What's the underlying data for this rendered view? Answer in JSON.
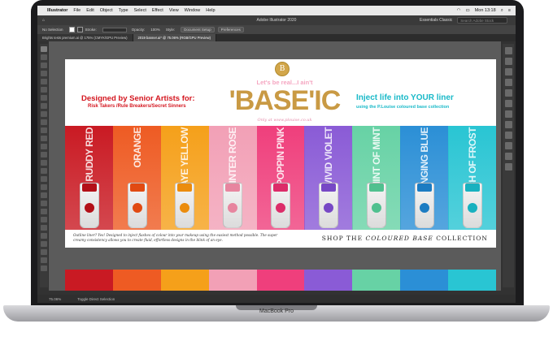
{
  "device": {
    "label": "MacBook Pro"
  },
  "menubar": {
    "app_name": "Illustrator",
    "items": [
      "File",
      "Edit",
      "Object",
      "Type",
      "Select",
      "Effect",
      "View",
      "Window",
      "Help"
    ],
    "clock": "Mon 13:18"
  },
  "control": {
    "title": "Adobe Illustrator 2020",
    "workspace": "Essentials Classic",
    "search_placeholder": "Search Adobe Stock"
  },
  "options": {
    "selection": "No Selection",
    "stroke_label": "Stroke:",
    "opacity_label": "Opacity:",
    "opacity_value": "100%",
    "style_label": "Style:",
    "doc_setup": "Document Setup",
    "preferences": "Preferences"
  },
  "tabs": [
    {
      "label": "Brights tests premium.ai @ 175% (CMYK/GPU Preview)"
    },
    {
      "label": "2019 banner.ai* @ 75.06% (RGB/GPU Preview)"
    }
  ],
  "artwork": {
    "tagline": "Let's be real...I ain't",
    "logo_letter": "B",
    "title": "'BASE'IC",
    "title_sub": "Only at www.plouise.co.uk",
    "left_heading": "Designed by Senior Artists for:",
    "left_sub": "Risk Takers /Rule Breakers/Secret Sinners",
    "right_heading": "Inject life into YOUR liner",
    "right_sub": "using the P.Louise coloured base collection",
    "body": "Outline liner? Yes! Designed to inject flashes of colour into your makeup using the easiest method possible. The super creamy consistency allows you to create fluid, effortless designs in the blink of an eye.",
    "shop_prefix": "SHOP THE ",
    "shop_emph": "COLOURED BASE",
    "shop_suffix": " COLLECTION",
    "strips": [
      {
        "label": "RUDDY RED",
        "color": "#c91a23",
        "cap": "#b31018"
      },
      {
        "label": "ORANGE",
        "color": "#ee5b23",
        "cap": "#e14a12"
      },
      {
        "label": "BEES AYE YELLOW",
        "color": "#f5a01a",
        "cap": "#eb8c0d"
      },
      {
        "label": "WINTER ROSE",
        "color": "#f2a0b6",
        "cap": "#e7859f"
      },
      {
        "label": "POPPIN PINK",
        "color": "#ef3f7c",
        "cap": "#dc2c69"
      },
      {
        "label": "VIVID VIOLET",
        "color": "#8a5bd6",
        "cap": "#7748c5"
      },
      {
        "label": "HINT OF MINT",
        "color": "#67d2a5",
        "cap": "#50c08f"
      },
      {
        "label": "BANGING BLUE",
        "color": "#2b8fd6",
        "cap": "#1c7cc2"
      },
      {
        "label": "TOUCH OF FROST",
        "color": "#29c5d3",
        "cap": "#18b1bf"
      }
    ]
  },
  "status": {
    "zoom": "75.06%",
    "tool": "Toggle Direct Selection"
  },
  "colors": {
    "accent_red": "#d4161f",
    "accent_cyan": "#19b9c8",
    "gold": "#c99a44"
  }
}
